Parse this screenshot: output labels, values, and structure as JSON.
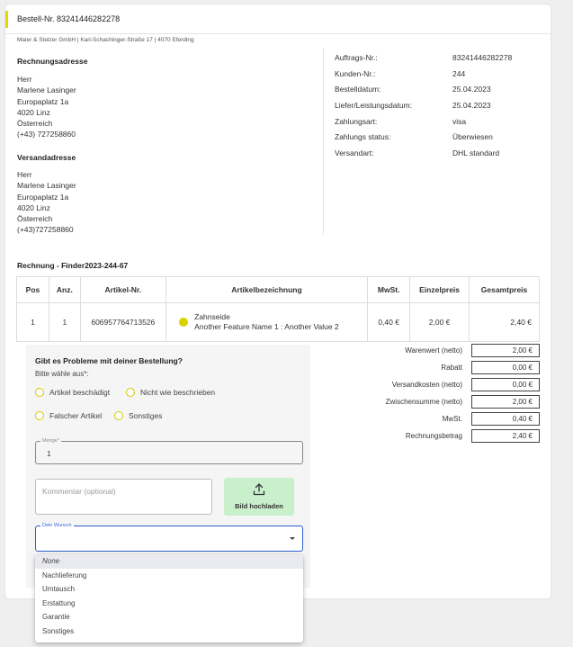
{
  "order": {
    "title": "Bestell-Nr. 83241446282278",
    "company_line": "Maier & Stelzer GmbH | Karl-Schachinger-Straße 17 | 4070 Eferding",
    "accent_color": "#e5d800"
  },
  "billing": {
    "heading": "Rechnungsadresse",
    "lines": [
      "Herr",
      "Marlene  Lasinger",
      "Europaplatz  1a",
      "4020  Linz",
      "Österreich",
      "(+43) 727258860"
    ]
  },
  "shipping": {
    "heading": "Versandadresse",
    "lines": [
      "Herr",
      "Marlene  Lasinger",
      "Europaplatz  1a",
      "4020 Linz",
      "Österreich",
      "(+43)727258860"
    ]
  },
  "meta": [
    {
      "key": "Auftrags-Nr.:",
      "value": "83241446282278"
    },
    {
      "key": "Kunden-Nr.:",
      "value": "244"
    },
    {
      "key": "Bestelldatum:",
      "value": "25.04.2023"
    },
    {
      "key": "Liefer/Leistungsdatum:",
      "value": "25.04.2023"
    },
    {
      "key": "Zahlungsart:",
      "value": "visa"
    },
    {
      "key": "Zahlungs status:",
      "value": "Überwiesen"
    },
    {
      "key": "Versandart:",
      "value": "DHL standard"
    }
  ],
  "invoice": {
    "title": "Rechnung - Finder2023-244-67",
    "headers": [
      "Pos",
      "Anz.",
      "Artikel-Nr.",
      "Artikelbezeichnung",
      "MwSt.",
      "Einzelpreis",
      "Gesamtpreis"
    ],
    "rows": [
      {
        "pos": "1",
        "qty": "1",
        "article_no": "606957764713526",
        "name": "Zahnseide",
        "feature": "Another Feature Name 1 : Another Value 2",
        "vat": "0,40 €",
        "unit_price": "2,00 €",
        "total_price": "2,40 €",
        "dot_color": "#d9d200"
      }
    ]
  },
  "totals": [
    {
      "label": "Warenwert (netto)",
      "value": "2,00 €"
    },
    {
      "label": "Rabatt",
      "value": "0,00 €"
    },
    {
      "label": "Versandkosten (netto)",
      "value": "0,00 €"
    },
    {
      "label": "Zwischensumme (netto)",
      "value": "2,00 €"
    },
    {
      "label": "MwSt.",
      "value": "0,40 €"
    },
    {
      "label": "Rechnungsbetrag",
      "value": "2,40 €"
    }
  ],
  "problem": {
    "title": "Gibt es Probleme mit deiner Bestellung?",
    "subtitle": "Bitte wähle aus*:",
    "options": [
      "Artikel beschädigt",
      "Nicht wie beschrieben",
      "Falscher Artikel",
      "Sonstiges"
    ],
    "quantity_label": "Menge*",
    "quantity_value": "1",
    "comment_placeholder": "Kommentar (optional)",
    "upload_label": "Bild hochladen",
    "wish_label": "Dein Wunsch",
    "wish_options": [
      "None",
      "Nachlieferung",
      "Umtausch",
      "Erstattung",
      "Garantie",
      "Sonstiges"
    ],
    "radio_color": "#d4c700",
    "upload_color": "#c8f0cb"
  }
}
